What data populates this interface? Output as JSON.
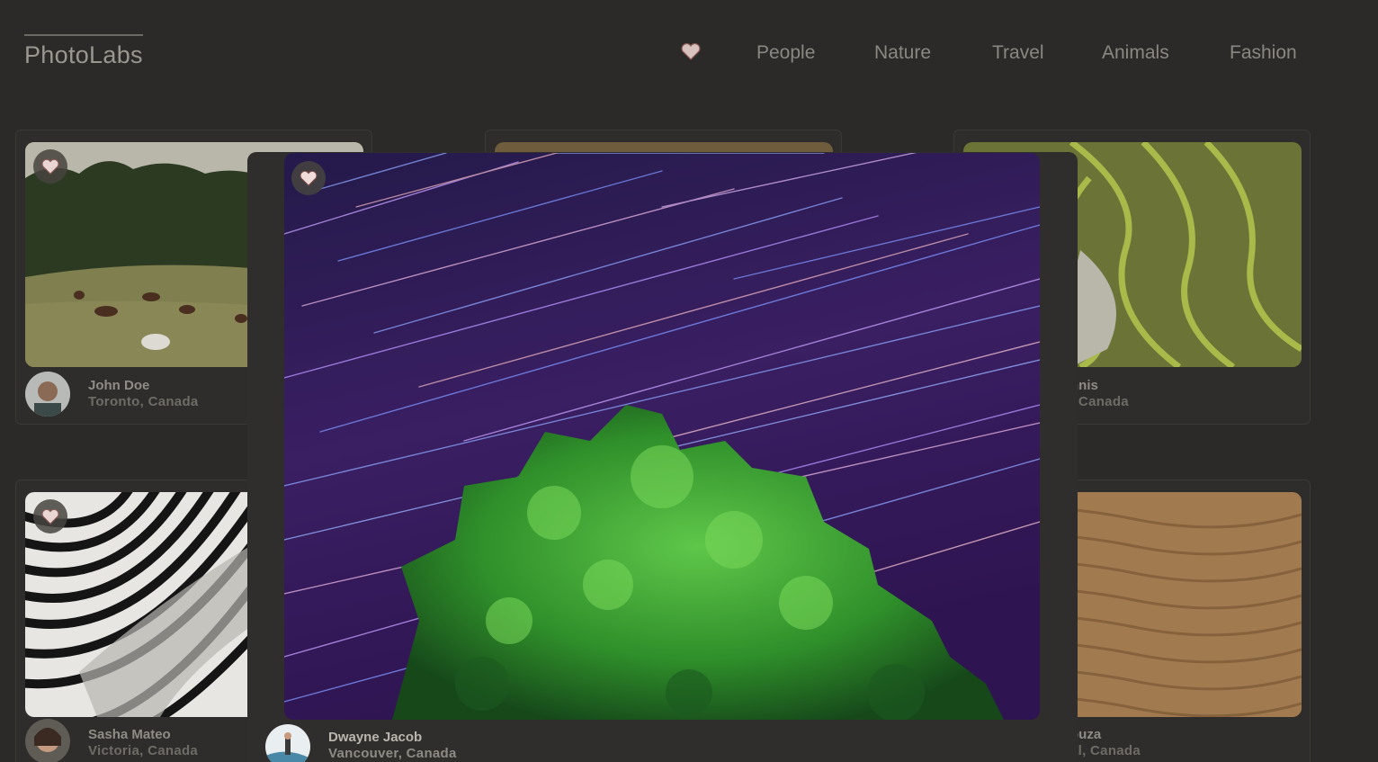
{
  "app": {
    "title": "PhotoLabs"
  },
  "nav": {
    "favorites_icon": "heart-icon",
    "topics": [
      "People",
      "Nature",
      "Travel",
      "Animals",
      "Fashion"
    ]
  },
  "photos": [
    {
      "name": "John Doe",
      "location": "Toronto, Canada"
    },
    {
      "name": "",
      "location": ""
    },
    {
      "name": "nnis",
      "location": ", Canada"
    },
    {
      "name": "Sasha Mateo",
      "location": "Victoria, Canada"
    },
    {
      "name": "ouza",
      "location": "al, Canada"
    }
  ],
  "modal": {
    "name": "Dwayne Jacob",
    "location": "Vancouver, Canada"
  },
  "colors": {
    "background": "#2b2a28",
    "heart_fill": "#f0ddd9",
    "heart_outline": "#7a4a48"
  }
}
